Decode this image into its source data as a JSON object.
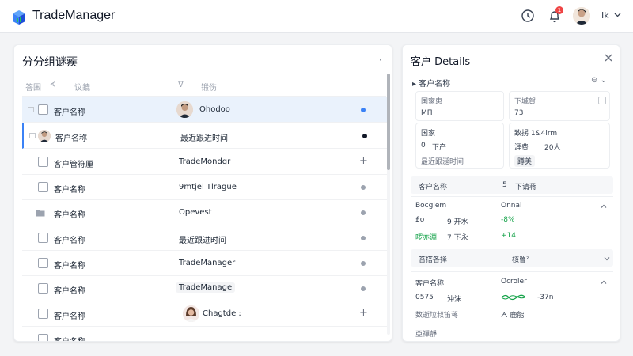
{
  "app": {
    "title": "TradeManager"
  },
  "topbar": {
    "notification_count": "1",
    "user_initials": "Ik"
  },
  "left_panel": {
    "title": "分分组谜蒺",
    "menu_glyph": "·",
    "headers": [
      "答围",
      "ᗉ",
      "议鎞",
      "ᐁ",
      "锻伤"
    ],
    "rows": [
      {
        "name": "客户名称",
        "value": "Ohodoo",
        "marker": "dot-blue",
        "selected": true
      },
      {
        "name": "客户名称",
        "value": "最近跟进时间",
        "marker": "dot-black",
        "active": true
      },
      {
        "name": "客户管符厘",
        "value": "TradeMondgr",
        "marker": "plus"
      },
      {
        "name": "客户名称",
        "value": "9mtjel Tlrague",
        "marker": "dot"
      },
      {
        "name": "客户名称",
        "value": "Opevest",
        "marker": "dot"
      },
      {
        "name": "客户名称",
        "value": "最近跟进时间",
        "marker": "dot"
      },
      {
        "name": "客户名称",
        "value": "TradeManager",
        "marker": "dot"
      },
      {
        "name": "客户名称",
        "value": "TradeManage",
        "marker": "dot"
      },
      {
        "name": "客户名称",
        "value": "Chagtde :",
        "marker": "plus"
      },
      {
        "name": "客户名称",
        "value": "",
        "marker": "none"
      }
    ]
  },
  "right_panel": {
    "title": "客户 Details",
    "section_label": "客户名称",
    "section_ctrl": "⊖ ⌄",
    "card1": {
      "label": "国家患",
      "value": "MΠ"
    },
    "card2": {
      "label": "下城賀",
      "value": "73"
    },
    "card3": {
      "label": "国家",
      "v1": "0",
      "v2": "下产",
      "sub": "最近跟涎时间"
    },
    "card4": {
      "label": "致拐 1&4irm",
      "v1": "涯费",
      "v2": "20人",
      "chip": "蹲美"
    },
    "bar1": {
      "left": "客户名称",
      "mid": "5",
      "right": "下请蒋"
    },
    "metrics": {
      "h1": "Bocglem",
      "h2": "Onnal",
      "r1a": "£o",
      "r1b": "9 开水",
      "r1c": "-8%",
      "r2a": "啰亦淵",
      "r2b": "7 下永",
      "r2c": "+14"
    },
    "bar2": {
      "left": "笞搭各择",
      "right": "核罾ˀ"
    },
    "section3": {
      "h1": "客户名称",
      "h2": "Ocroler",
      "r1a": "0575",
      "r1b": "沖沫",
      "r1c": "-37n",
      "r2a": "数逝垃叔笛蒋",
      "r2b": "ᗅ 鹿能",
      "r3": "亞禪靜"
    }
  },
  "colors": {
    "accent": "#3b82f6",
    "selected_row": "#eaf2fc",
    "badge": "#ef4444",
    "positive": "#16a34a"
  }
}
